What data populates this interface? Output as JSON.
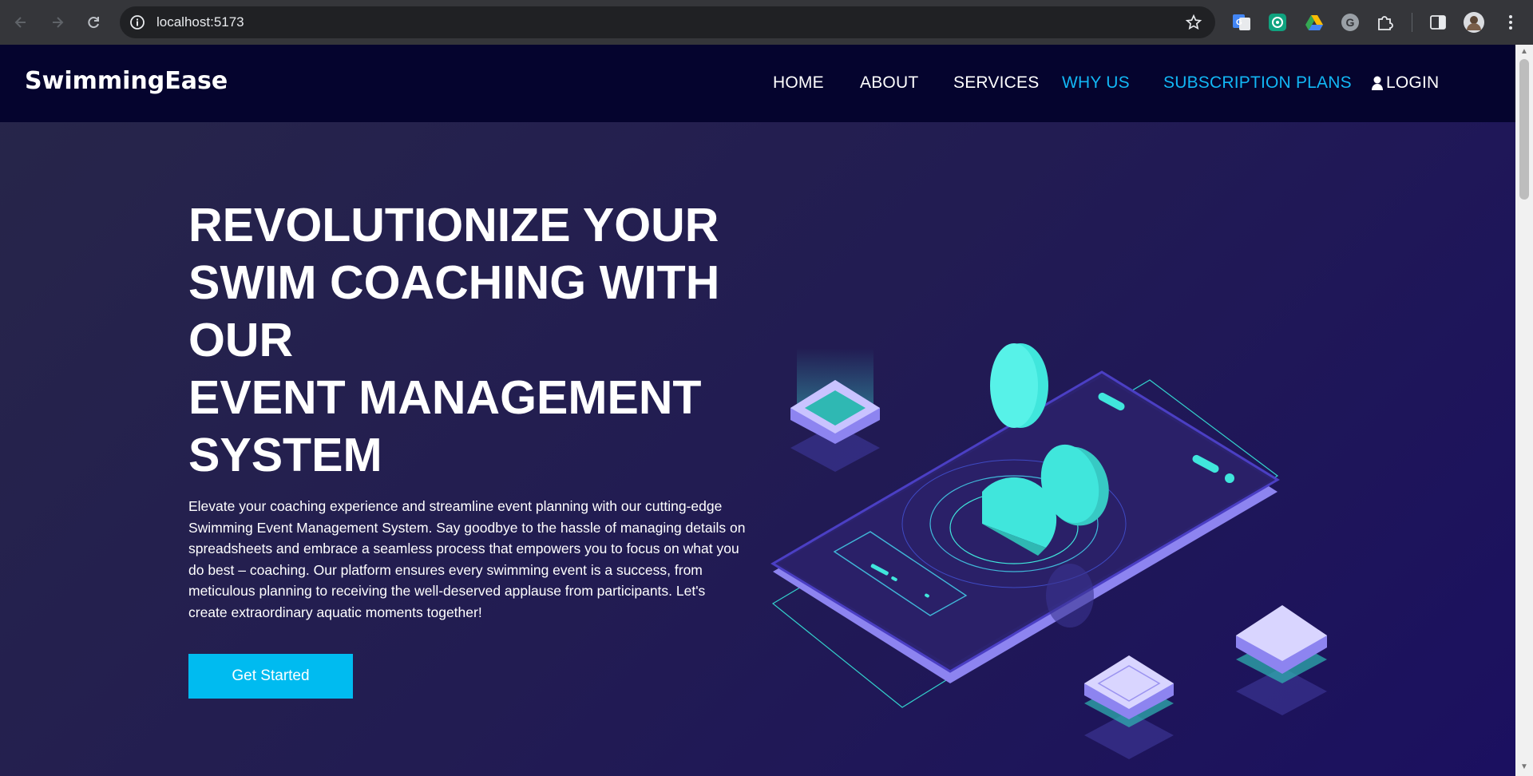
{
  "browser": {
    "url": "localhost:5173",
    "back_icon": "arrow-left-icon",
    "forward_icon": "arrow-right-icon",
    "reload_icon": "reload-icon"
  },
  "nav": {
    "brand": "SwimmingEase",
    "items": [
      {
        "label": "HOME",
        "color": "#ffffff"
      },
      {
        "label": "ABOUT",
        "color": "#ffffff"
      },
      {
        "label": "SERVICES",
        "color": "#ffffff"
      },
      {
        "label": "WHY US",
        "color": "#12b7f5"
      },
      {
        "label": "SUBSCRIPTION PLANS",
        "color": "#12b7f5"
      }
    ],
    "login": "LOGIN"
  },
  "hero": {
    "title_lines": [
      "REVOLUTIONIZE YOUR",
      "SWIM COACHING WITH",
      "OUR",
      "EVENT MANAGEMENT",
      "SYSTEM"
    ],
    "text_lines": [
      "Elevate your coaching experience and streamline event planning with our cutting-edge",
      "Swimming Event Management System. Say goodbye to the hassle of managing details on",
      "spreadsheets and embrace a seamless process that empowers you to focus on what you",
      "do best – coaching. Our platform ensures every swimming event is a success, from",
      "meticulous planning to receiving the well-deserved applause from participants. Let's",
      "create extraordinary aquatic moments together!"
    ],
    "cta": "Get Started"
  },
  "colors": {
    "nav_bg": "#05042e",
    "accent": "#12b7f5",
    "cta_bg": "#00bbf0",
    "illustration_teal": "#40e6dc",
    "illustration_purple": "#2c2370"
  }
}
